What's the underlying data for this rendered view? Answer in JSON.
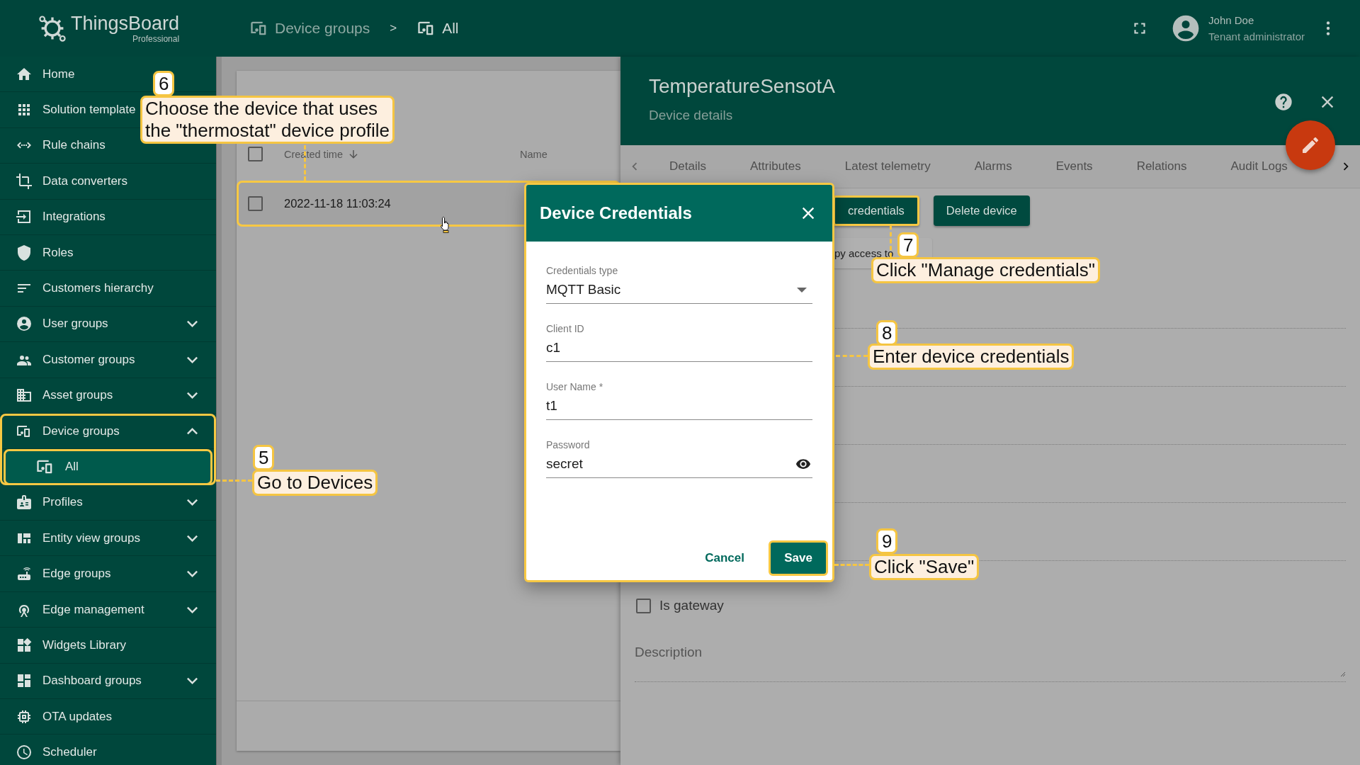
{
  "header": {
    "logo": {
      "name": "ThingsBoard",
      "edition": "Professional"
    },
    "breadcrumbs": [
      {
        "label": "Device groups",
        "current": false
      },
      {
        "label": "All",
        "current": true
      }
    ],
    "separator": ">",
    "user": {
      "name": "John Doe",
      "role": "Tenant administrator"
    }
  },
  "sidebar": {
    "items": [
      {
        "label": "Home",
        "selected": false
      },
      {
        "label": "Solution template",
        "selected": false
      },
      {
        "label": "Rule chains",
        "selected": false
      },
      {
        "label": "Data converters",
        "selected": false
      },
      {
        "label": "Integrations",
        "selected": false
      },
      {
        "label": "Roles",
        "selected": false
      },
      {
        "label": "Customers hierarchy",
        "selected": false
      },
      {
        "label": "User groups",
        "selected": false,
        "expanded": false
      },
      {
        "label": "Customer groups",
        "selected": false,
        "expanded": false
      },
      {
        "label": "Asset groups",
        "selected": false,
        "expanded": false
      },
      {
        "label": "Device groups",
        "selected": false,
        "expanded": true,
        "highlighted": true,
        "children": [
          {
            "label": "All",
            "selected": true,
            "highlighted": true
          }
        ]
      },
      {
        "label": "Profiles",
        "selected": false,
        "expanded": false
      },
      {
        "label": "Entity view groups",
        "selected": false,
        "expanded": false
      },
      {
        "label": "Edge groups",
        "selected": false,
        "expanded": false
      },
      {
        "label": "Edge management",
        "selected": false,
        "expanded": false
      },
      {
        "label": "Widgets Library",
        "selected": false
      },
      {
        "label": "Dashboard groups",
        "selected": false,
        "expanded": false
      },
      {
        "label": "OTA updates",
        "selected": false
      },
      {
        "label": "Scheduler",
        "selected": false
      }
    ]
  },
  "devices": {
    "select_all": {
      "checked": false
    },
    "columns": [
      {
        "label": "Created time",
        "sorted": true
      },
      {
        "label": "Name",
        "sorted": false
      }
    ],
    "rows": [
      {
        "checked": false,
        "created_time": "2022-11-18 11:03:24",
        "highlighted": true
      }
    ]
  },
  "details": {
    "title": "TemperatureSensotA",
    "subtitle": "Device details",
    "tabs": [
      {
        "label": "Details"
      },
      {
        "label": "Attributes"
      },
      {
        "label": "Latest telemetry"
      },
      {
        "label": "Alarms"
      },
      {
        "label": "Events"
      },
      {
        "label": "Relations"
      },
      {
        "label": "Audit Logs"
      }
    ],
    "buttons": [
      {
        "label": "credentials",
        "highlighted": true
      },
      {
        "label": "Delete device",
        "highlighted": false
      }
    ],
    "copy_button": "py access to",
    "is_gateway": {
      "label": "Is gateway",
      "checked": false
    },
    "description": {
      "label": "Description"
    }
  },
  "dialog": {
    "title": "Device Credentials",
    "highlighted": true,
    "fields": [
      {
        "kind": "select",
        "label": "Credentials type",
        "value": "MQTT Basic"
      },
      {
        "kind": "text",
        "label": "Client ID",
        "value": "c1"
      },
      {
        "kind": "text",
        "label": "User Name *",
        "value": "t1"
      },
      {
        "kind": "password",
        "label": "Password",
        "value": "secret"
      }
    ],
    "cancel": "Cancel",
    "save": {
      "label": "Save",
      "highlighted": true
    }
  },
  "annotations": [
    {
      "number": "6",
      "lines": [
        "Choose the device that uses",
        "the \"thermostat\" device profile"
      ]
    },
    {
      "number": "7",
      "lines": [
        "Click \"Manage credentials\""
      ]
    },
    {
      "number": "8",
      "lines": [
        "Enter device credentials"
      ]
    },
    {
      "number": "5",
      "lines": [
        "Go to Devices"
      ]
    },
    {
      "number": "9",
      "lines": [
        "Click \"Save\""
      ]
    }
  ]
}
